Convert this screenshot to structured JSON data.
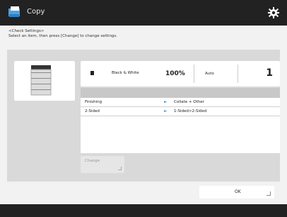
{
  "header": {
    "title": "Copy",
    "app_icon": "copy-icon",
    "settings_icon": "gear-icon"
  },
  "instructions": {
    "line1": "<Check Settings>",
    "line2": "Select an item, then press [Change] to change settings."
  },
  "summary": {
    "color_mode": "Black & White",
    "copy_ratio": "100%",
    "paper": "Auto",
    "quantity": "1"
  },
  "settings_list": [
    {
      "name": "Finishing",
      "value": "Collate + Other"
    },
    {
      "name": "2-Sided",
      "value": "1-Sided>2-Sided"
    }
  ],
  "buttons": {
    "change": "Change",
    "ok": "OK"
  },
  "colors": {
    "titlebar": "#222222",
    "panel": "#d9d9d9",
    "accent_arrow": "#4a8fd0"
  }
}
